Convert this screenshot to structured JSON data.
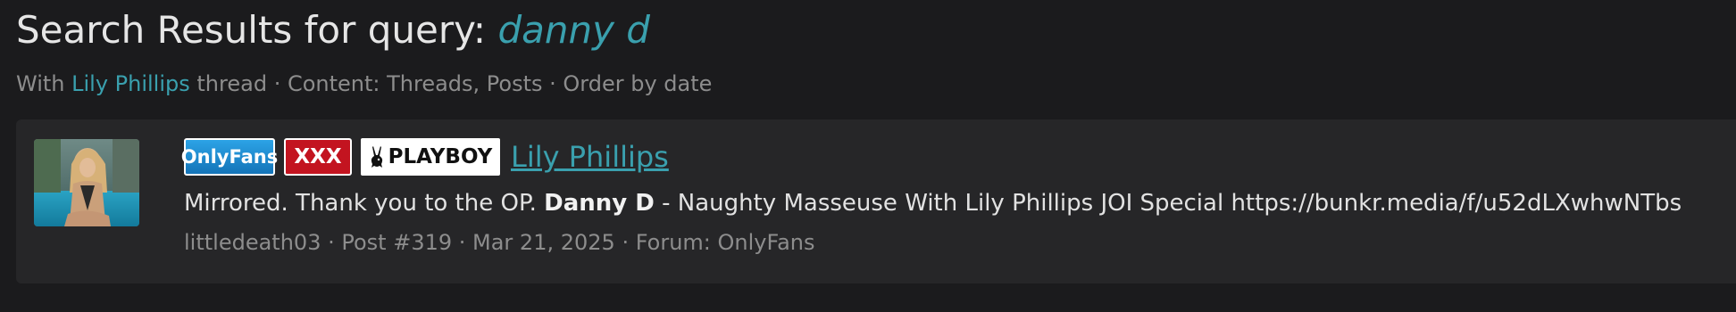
{
  "header": {
    "title_prefix": "Search Results for query: ",
    "query": "danny d",
    "meta_with": "With ",
    "meta_user": "Lily Phillips",
    "meta_rest": " thread · Content: Threads, Posts · Order by date"
  },
  "result": {
    "badges": {
      "onlyfans": "OnlyFans",
      "xxx": "XXX",
      "playboy": "PLAYBOY"
    },
    "thread_title": "Lily Phillips",
    "snippet_before": "Mirrored. Thank you to the OP. ",
    "snippet_highlight": "Danny D",
    "snippet_after": " - Naughty Masseuse With Lily Phillips JOI Special https://bunkr.media/f/u52dLXwhwNTbs",
    "author": "littledeath03",
    "post_number": "Post #319",
    "date": "Mar 21, 2025",
    "forum_label": "Forum: ",
    "forum": "OnlyFans",
    "separator": " · "
  },
  "colors": {
    "background": "#1b1b1d",
    "card": "#262628",
    "accent": "#3aa0ae",
    "muted": "#8d8d8d"
  },
  "icons": {
    "thumbnail": "avatar-thumbnail",
    "playboy_logo": "bunny-icon"
  }
}
